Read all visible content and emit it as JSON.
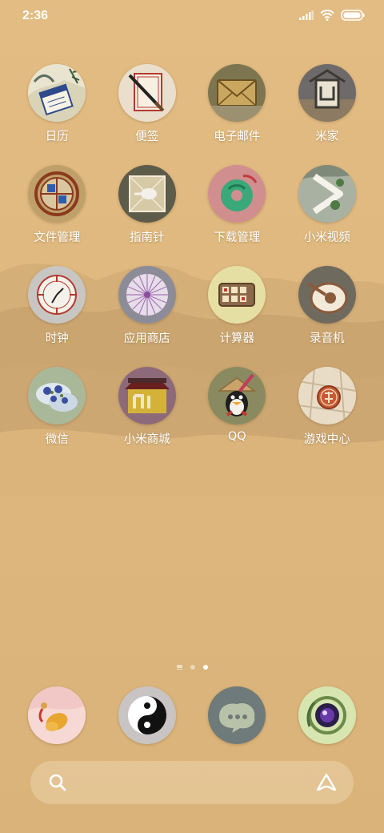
{
  "status_bar": {
    "time": "2:36"
  },
  "apps": [
    {
      "label": "日历",
      "icon": "calendar-icon"
    },
    {
      "label": "便签",
      "icon": "notes-icon"
    },
    {
      "label": "电子邮件",
      "icon": "email-icon"
    },
    {
      "label": "米家",
      "icon": "mijia-icon"
    },
    {
      "label": "文件管理",
      "icon": "file-manager-icon"
    },
    {
      "label": "指南针",
      "icon": "compass-icon"
    },
    {
      "label": "下载管理",
      "icon": "download-manager-icon"
    },
    {
      "label": "小米视频",
      "icon": "video-icon"
    },
    {
      "label": "时钟",
      "icon": "clock-icon"
    },
    {
      "label": "应用商店",
      "icon": "app-store-icon"
    },
    {
      "label": "计算器",
      "icon": "calculator-icon"
    },
    {
      "label": "录音机",
      "icon": "recorder-icon"
    },
    {
      "label": "微信",
      "icon": "wechat-icon"
    },
    {
      "label": "小米商城",
      "icon": "mi-store-icon"
    },
    {
      "label": "QQ",
      "icon": "qq-icon"
    },
    {
      "label": "游戏中心",
      "icon": "game-center-icon"
    }
  ],
  "page_indicator": {
    "pages": 3,
    "current": 3
  },
  "dock": [
    {
      "icon": "phone-icon"
    },
    {
      "icon": "contacts-icon"
    },
    {
      "icon": "messages-icon"
    },
    {
      "icon": "camera-icon"
    }
  ],
  "search_bar": {
    "left_icon": "search-icon",
    "right_icon": "assistant-icon"
  },
  "colors": {
    "background": "#dfb97f",
    "label_text": "#ffffff"
  }
}
